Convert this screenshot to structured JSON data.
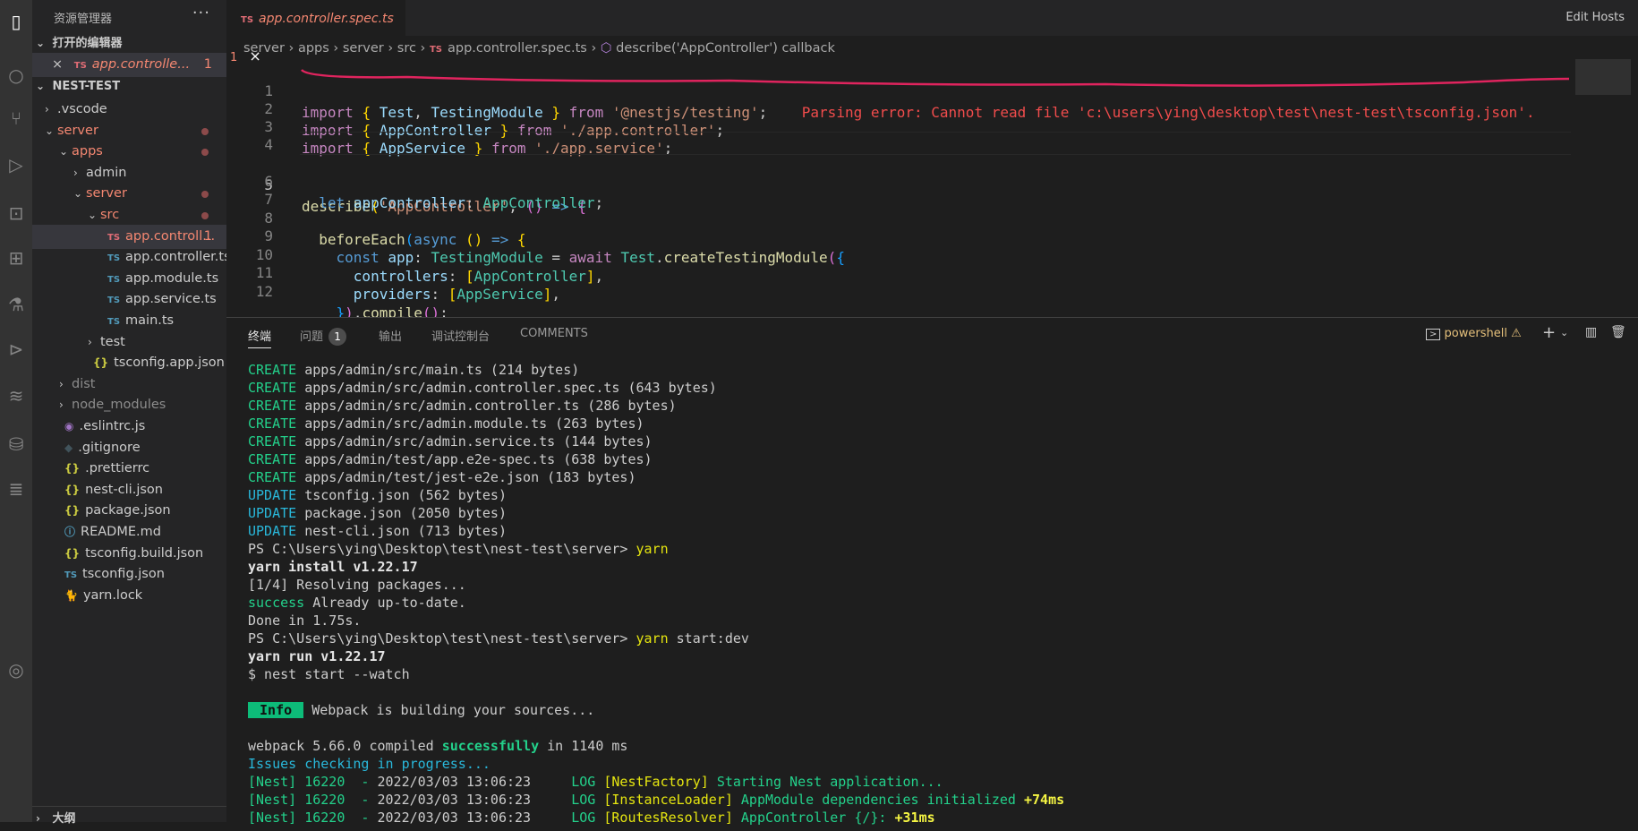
{
  "sidebar": {
    "title": "资源管理器",
    "more": "···",
    "open_editors_label": "打开的编辑器",
    "open_editor": {
      "close": "×",
      "type": "TS",
      "name": "app.controlle...",
      "badge": "1"
    },
    "project_label": "NEST-TEST",
    "tree": [
      {
        "type": "folder",
        "indent": 0,
        "open": false,
        "name": ".vscode"
      },
      {
        "type": "folder",
        "indent": 0,
        "open": true,
        "name": "server",
        "dot": true,
        "red": true
      },
      {
        "type": "folder",
        "indent": 1,
        "open": true,
        "name": "apps",
        "dot": true,
        "red": true
      },
      {
        "type": "folder",
        "indent": 2,
        "open": false,
        "name": "admin"
      },
      {
        "type": "folder",
        "indent": 2,
        "open": true,
        "name": "server",
        "dot": true,
        "red": true
      },
      {
        "type": "folder",
        "indent": 3,
        "open": true,
        "name": "src",
        "dot": true,
        "red": true
      },
      {
        "type": "ts",
        "indent": 4,
        "name": "app.controll...",
        "badge": "1",
        "red": true,
        "selected": true
      },
      {
        "type": "ts",
        "indent": 4,
        "name": "app.controller.ts"
      },
      {
        "type": "ts",
        "indent": 4,
        "name": "app.module.ts"
      },
      {
        "type": "ts",
        "indent": 4,
        "name": "app.service.ts"
      },
      {
        "type": "ts",
        "indent": 4,
        "name": "main.ts"
      },
      {
        "type": "folder",
        "indent": 3,
        "open": false,
        "name": "test"
      },
      {
        "type": "json",
        "indent": 3,
        "name": "tsconfig.app.json"
      },
      {
        "type": "folder",
        "indent": 1,
        "open": false,
        "name": "dist",
        "dim": true
      },
      {
        "type": "folder",
        "indent": 1,
        "open": false,
        "name": "node_modules",
        "dim": true
      },
      {
        "type": "eslint",
        "indent": 1,
        "name": ".eslintrc.js"
      },
      {
        "type": "git",
        "indent": 1,
        "name": ".gitignore"
      },
      {
        "type": "json",
        "indent": 1,
        "name": ".prettierrc"
      },
      {
        "type": "json",
        "indent": 1,
        "name": "nest-cli.json"
      },
      {
        "type": "json",
        "indent": 1,
        "name": "package.json"
      },
      {
        "type": "info",
        "indent": 1,
        "name": "README.md"
      },
      {
        "type": "json",
        "indent": 1,
        "name": "tsconfig.build.json"
      },
      {
        "type": "tsconfig",
        "indent": 1,
        "name": "tsconfig.json"
      },
      {
        "type": "yarn",
        "indent": 1,
        "name": "yarn.lock"
      }
    ],
    "footer": "大纲"
  },
  "editor": {
    "tab": {
      "type": "TS",
      "name": "app.controller.spec.ts",
      "badge": "1",
      "close": "×"
    },
    "edit_hosts": "Edit Hosts",
    "breadcrumb": [
      "server",
      "apps",
      "server",
      "src",
      "app.controller.spec.ts",
      "describe('AppController') callback"
    ],
    "error_text": "Parsing error: Cannot read file 'c:\\users\\ying\\desktop\\test\\nest-test\\tsconfig.json'.",
    "line_numbers": [
      "1",
      "2",
      "3",
      "4",
      "5",
      "6",
      "7",
      "8",
      "9",
      "10",
      "11",
      "12"
    ]
  },
  "panel": {
    "tabs": [
      "终端",
      "问题",
      "输出",
      "调试控制台",
      "COMMENTS"
    ],
    "problems_count": "1",
    "shell": "powershell",
    "terminal": [
      [
        [
          "g",
          "CREATE "
        ],
        [
          "",
          "apps/admin/src/main.ts (214 bytes)"
        ]
      ],
      [
        [
          "g",
          "CREATE "
        ],
        [
          "",
          "apps/admin/src/admin.controller.spec.ts (643 bytes)"
        ]
      ],
      [
        [
          "g",
          "CREATE "
        ],
        [
          "",
          "apps/admin/src/admin.controller.ts (286 bytes)"
        ]
      ],
      [
        [
          "g",
          "CREATE "
        ],
        [
          "",
          "apps/admin/src/admin.module.ts (263 bytes)"
        ]
      ],
      [
        [
          "g",
          "CREATE "
        ],
        [
          "",
          "apps/admin/src/admin.service.ts (144 bytes)"
        ]
      ],
      [
        [
          "g",
          "CREATE "
        ],
        [
          "",
          "apps/admin/test/app.e2e-spec.ts (638 bytes)"
        ]
      ],
      [
        [
          "g",
          "CREATE "
        ],
        [
          "",
          "apps/admin/test/jest-e2e.json (183 bytes)"
        ]
      ],
      [
        [
          "c",
          "UPDATE "
        ],
        [
          "",
          "tsconfig.json (562 bytes)"
        ]
      ],
      [
        [
          "c",
          "UPDATE "
        ],
        [
          "",
          "package.json (2050 bytes)"
        ]
      ],
      [
        [
          "c",
          "UPDATE "
        ],
        [
          "",
          "nest-cli.json (713 bytes)"
        ]
      ],
      [
        [
          "",
          "PS C:\\Users\\ying\\Desktop\\test\\nest-test\\server> "
        ],
        [
          "y",
          "yarn"
        ]
      ],
      [
        [
          "b",
          "yarn install v1.22.17"
        ]
      ],
      [
        [
          "",
          "[1/4] Resolving packages..."
        ]
      ],
      [
        [
          "g",
          "success "
        ],
        [
          "",
          "Already up-to-date."
        ]
      ],
      [
        [
          "",
          "Done in 1.75s."
        ]
      ],
      [
        [
          "",
          "PS C:\\Users\\ying\\Desktop\\test\\nest-test\\server> "
        ],
        [
          "y",
          "yarn "
        ],
        [
          "",
          "start:dev"
        ]
      ],
      [
        [
          "b",
          "yarn run v1.22.17"
        ]
      ],
      [
        [
          "",
          "$ nest start --watch"
        ]
      ],
      [],
      [
        [
          "info",
          " Info "
        ],
        [
          "",
          " Webpack is building your sources..."
        ]
      ],
      [],
      [
        [
          "",
          "webpack 5.66.0 compiled "
        ],
        [
          "gb",
          "successfully"
        ],
        [
          "",
          " in 1140 ms"
        ]
      ],
      [
        [
          "c",
          "Issues checking in progress..."
        ]
      ],
      [
        [
          "g",
          "[Nest] 16220  - "
        ],
        [
          "",
          "2022/03/03 13:06:23     "
        ],
        [
          "g",
          "LOG "
        ],
        [
          "y",
          "[NestFactory] "
        ],
        [
          "g",
          "Starting Nest application..."
        ]
      ],
      [
        [
          "g",
          "[Nest] 16220  - "
        ],
        [
          "",
          "2022/03/03 13:06:23     "
        ],
        [
          "g",
          "LOG "
        ],
        [
          "y",
          "[InstanceLoader] "
        ],
        [
          "g",
          "AppModule dependencies initialized "
        ],
        [
          "yb",
          "+74ms"
        ]
      ],
      [
        [
          "g",
          "[Nest] 16220  - "
        ],
        [
          "",
          "2022/03/03 13:06:23     "
        ],
        [
          "g",
          "LOG "
        ],
        [
          "y",
          "[RoutesResolver] "
        ],
        [
          "g",
          "AppController {/}: "
        ],
        [
          "yb",
          "+31ms"
        ]
      ]
    ]
  }
}
